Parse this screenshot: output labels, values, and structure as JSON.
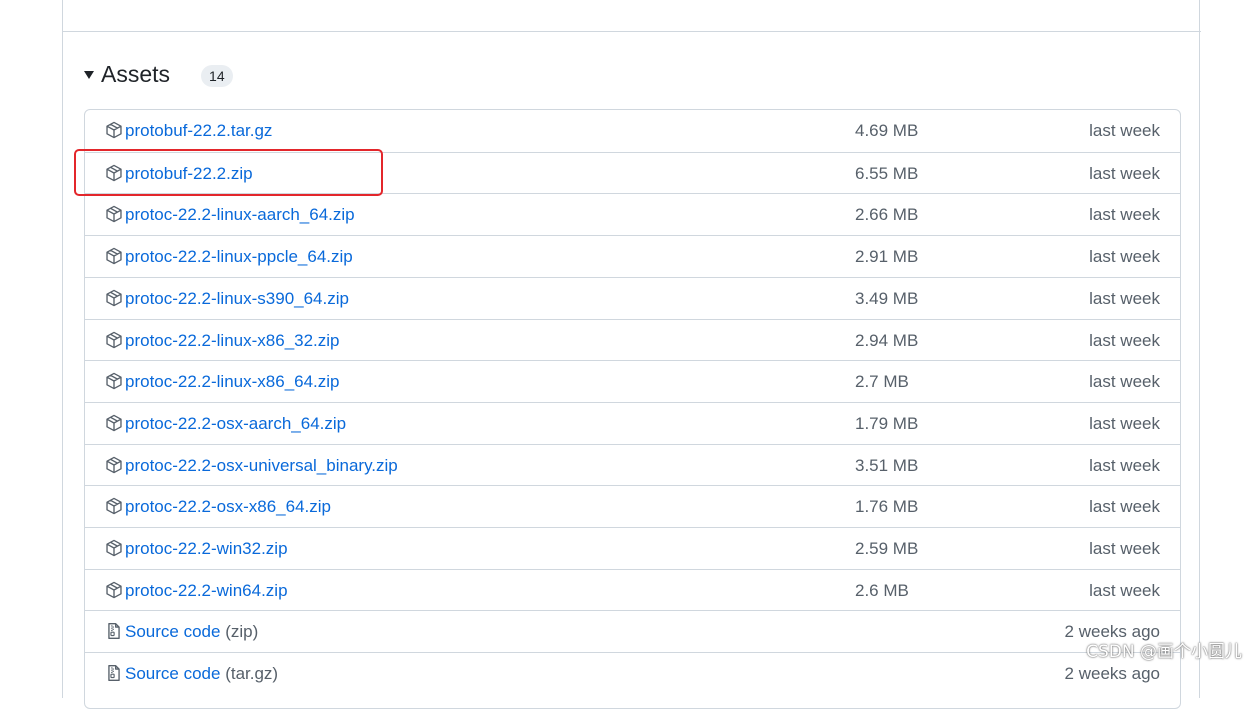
{
  "assets": {
    "title": "Assets",
    "count": "14",
    "items": [
      {
        "name": "protobuf-22.2.tar.gz",
        "size": "4.69 MB",
        "date": "last week",
        "kind": "package-icon"
      },
      {
        "name": "protobuf-22.2.zip",
        "size": "6.55 MB",
        "date": "last week",
        "kind": "package-icon"
      },
      {
        "name": "protoc-22.2-linux-aarch_64.zip",
        "size": "2.66 MB",
        "date": "last week",
        "kind": "package-icon"
      },
      {
        "name": "protoc-22.2-linux-ppcle_64.zip",
        "size": "2.91 MB",
        "date": "last week",
        "kind": "package-icon"
      },
      {
        "name": "protoc-22.2-linux-s390_64.zip",
        "size": "3.49 MB",
        "date": "last week",
        "kind": "package-icon"
      },
      {
        "name": "protoc-22.2-linux-x86_32.zip",
        "size": "2.94 MB",
        "date": "last week",
        "kind": "package-icon"
      },
      {
        "name": "protoc-22.2-linux-x86_64.zip",
        "size": "2.7 MB",
        "date": "last week",
        "kind": "package-icon"
      },
      {
        "name": "protoc-22.2-osx-aarch_64.zip",
        "size": "1.79 MB",
        "date": "last week",
        "kind": "package-icon"
      },
      {
        "name": "protoc-22.2-osx-universal_binary.zip",
        "size": "3.51 MB",
        "date": "last week",
        "kind": "package-icon"
      },
      {
        "name": "protoc-22.2-osx-x86_64.zip",
        "size": "1.76 MB",
        "date": "last week",
        "kind": "package-icon"
      },
      {
        "name": "protoc-22.2-win32.zip",
        "size": "2.59 MB",
        "date": "last week",
        "kind": "package-icon"
      },
      {
        "name": "protoc-22.2-win64.zip",
        "size": "2.6 MB",
        "date": "last week",
        "kind": "package-icon"
      },
      {
        "name": "Source code",
        "suffix": "(zip)",
        "size": "",
        "date": "2 weeks ago",
        "kind": "file-zip-icon"
      },
      {
        "name": "Source code",
        "suffix": "(tar.gz)",
        "size": "",
        "date": "2 weeks ago",
        "kind": "file-zip-icon"
      }
    ]
  },
  "watermark": "CSDN @画个小圆儿",
  "colors": {
    "link": "#0969da",
    "muted": "#57606a",
    "border": "#d0d7de",
    "highlight": "#e3262b"
  }
}
